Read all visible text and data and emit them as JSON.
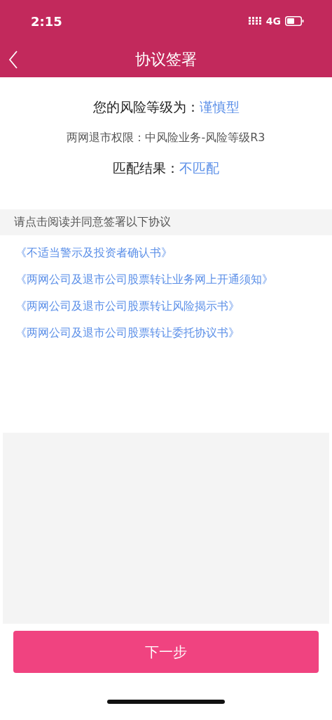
{
  "status_bar": {
    "time": "2:15",
    "network": "4G"
  },
  "nav": {
    "title": "协议签署"
  },
  "info": [
    {
      "label": "您的风险等级为：",
      "value": "谨慎型",
      "kind": "major"
    },
    {
      "label": "两网退市权限：中风险业务-风险等级R3",
      "kind": "minor"
    },
    {
      "label": "匹配结果：",
      "value": "不匹配",
      "kind": "major"
    }
  ],
  "agreements": {
    "heading": "请点击阅读并同意签署以下协议",
    "links": [
      "《不适当警示及投资者确认书》",
      "《两网公司及退市公司股票转让业务网上开通须知》",
      "《两网公司及退市公司股票转让风险揭示书》",
      "《两网公司及退市公司股票转让委托协议书》"
    ]
  },
  "next_button": {
    "label": "下一步"
  }
}
